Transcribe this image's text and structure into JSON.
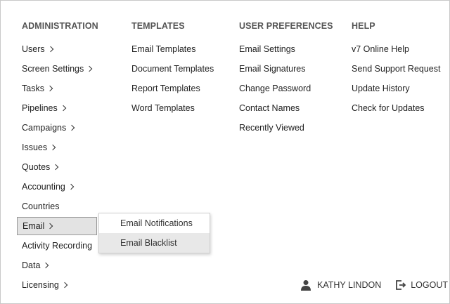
{
  "administration": {
    "heading": "ADMINISTRATION",
    "items": [
      {
        "label": "Users",
        "chevron": true
      },
      {
        "label": "Screen Settings",
        "chevron": true
      },
      {
        "label": "Tasks",
        "chevron": true
      },
      {
        "label": "Pipelines",
        "chevron": true
      },
      {
        "label": "Campaigns",
        "chevron": true
      },
      {
        "label": "Issues",
        "chevron": true
      },
      {
        "label": "Quotes",
        "chevron": true
      },
      {
        "label": "Accounting",
        "chevron": true
      },
      {
        "label": "Countries",
        "chevron": false
      },
      {
        "label": "Email",
        "chevron": true,
        "active": true
      },
      {
        "label": "Activity Recording",
        "chevron": false
      },
      {
        "label": "Data",
        "chevron": true
      },
      {
        "label": "Licensing",
        "chevron": true
      }
    ]
  },
  "templates": {
    "heading": "TEMPLATES",
    "items": [
      "Email Templates",
      "Document Templates",
      "Report Templates",
      "Word Templates"
    ]
  },
  "user_preferences": {
    "heading": "USER PREFERENCES",
    "items": [
      "Email Settings",
      "Email Signatures",
      "Change Password",
      "Contact Names",
      "Recently Viewed"
    ]
  },
  "help": {
    "heading": "HELP",
    "items": [
      "v7 Online Help",
      "Send Support Request",
      "Update History",
      "Check for Updates"
    ]
  },
  "email_submenu": {
    "items": [
      "Email Notifications",
      "Email Blacklist"
    ],
    "hovered_index": 1
  },
  "user": {
    "name": "KATHY LINDON",
    "icon": "user-icon"
  },
  "logout": {
    "label": "LOGOUT",
    "icon": "logout-icon"
  },
  "colors": {
    "active_bg": "#e3e3e3",
    "hover_bg": "#e8e8e8",
    "heading": "#555555"
  }
}
